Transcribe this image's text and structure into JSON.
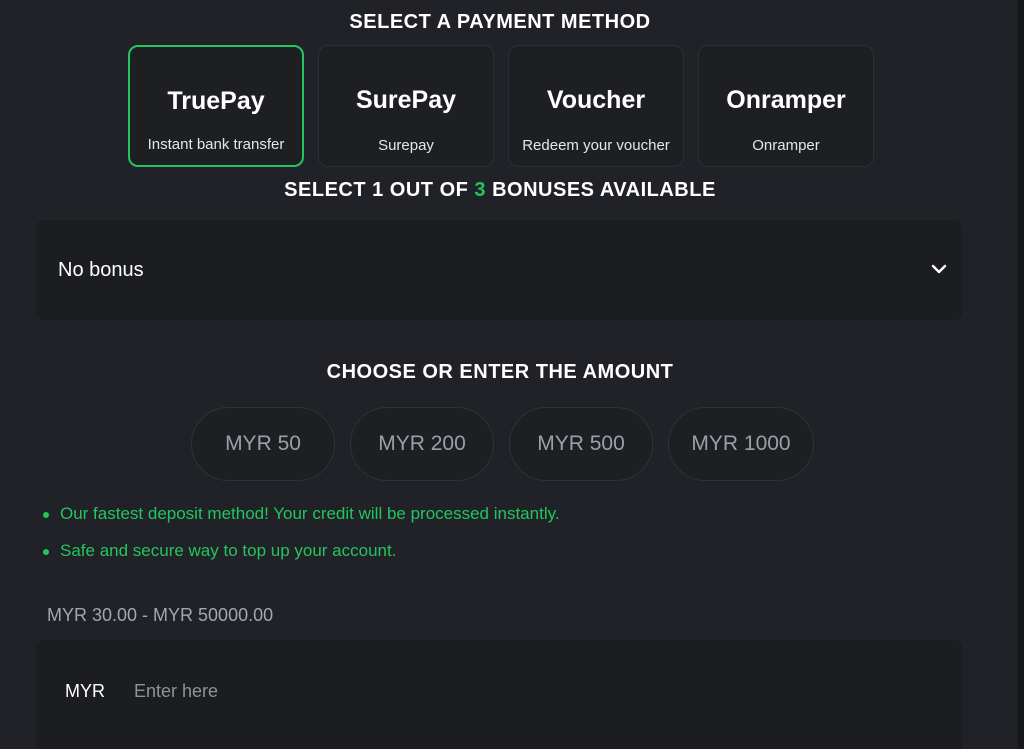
{
  "payment": {
    "title": "SELECT A PAYMENT METHOD",
    "methods": [
      {
        "name": "TruePay",
        "desc": "Instant bank transfer",
        "selected": true
      },
      {
        "name": "SurePay",
        "desc": "Surepay",
        "selected": false
      },
      {
        "name": "Voucher",
        "desc": "Redeem your voucher",
        "selected": false
      },
      {
        "name": "Onramper",
        "desc": "Onramper",
        "selected": false
      }
    ]
  },
  "bonus": {
    "title_prefix": "SELECT 1 OUT OF ",
    "count": "3",
    "title_suffix": " BONUSES AVAILABLE",
    "selected": "No bonus",
    "chevron_icon": "chevron-down-icon"
  },
  "amount": {
    "title": "CHOOSE OR ENTER THE AMOUNT",
    "options": [
      "MYR 50",
      "MYR 200",
      "MYR 500",
      "MYR 1000"
    ]
  },
  "features": [
    "Our fastest deposit method! Your credit will be processed instantly.",
    "Safe and secure way to top up your account."
  ],
  "range": "MYR 30.00 - MYR 50000.00",
  "input": {
    "currency": "MYR",
    "placeholder": "Enter here",
    "value": ""
  },
  "colors": {
    "accent": "#22c55e",
    "background": "#202227",
    "card": "#1d1f23"
  }
}
